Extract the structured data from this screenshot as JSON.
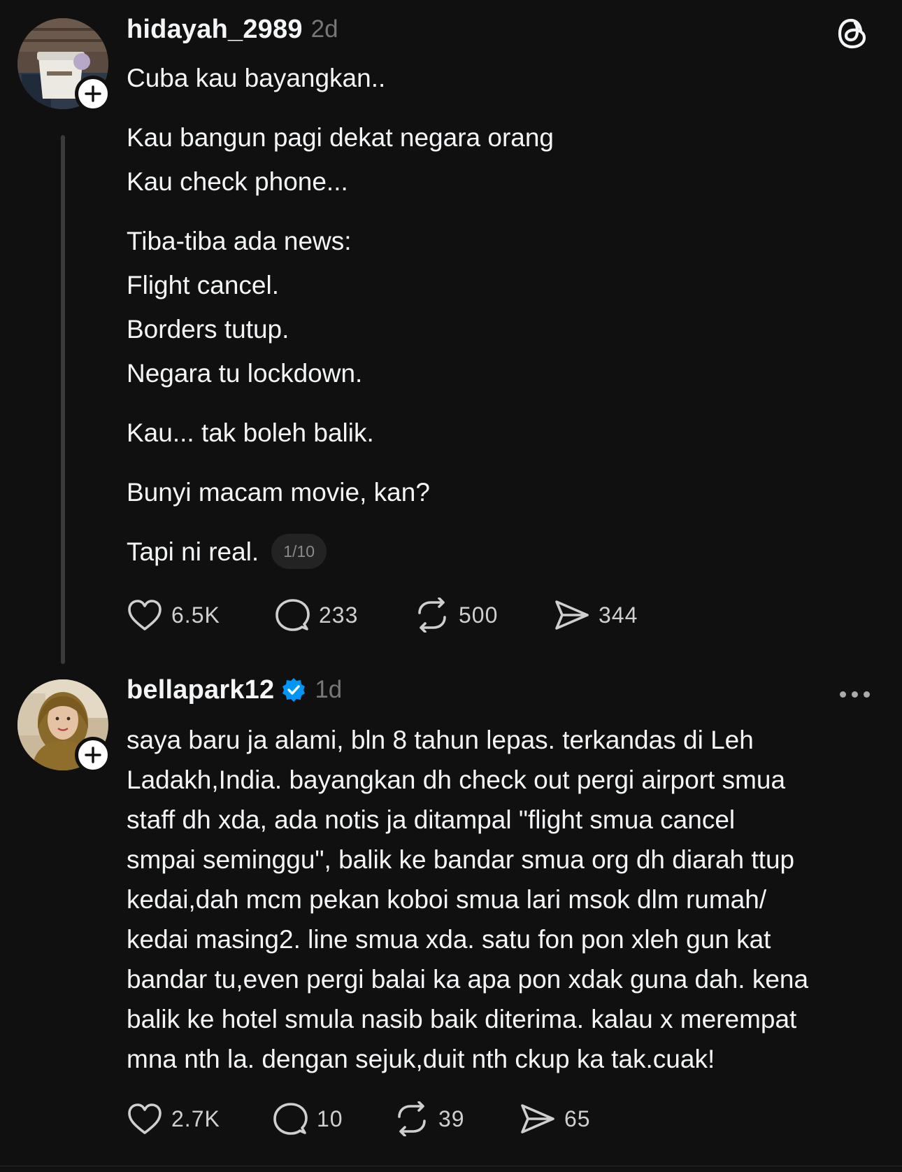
{
  "post1": {
    "username": "hidayah_2989",
    "time": "2d",
    "lines": [
      "Cuba kau bayangkan..",
      "",
      "Kau bangun pagi dekat negara orang",
      "Kau check phone...",
      "",
      "Tiba-tiba ada news:",
      "Flight cancel.",
      "Borders tutup.",
      "Negara tu lockdown.",
      "",
      "Kau... tak boleh balik.",
      "",
      "Bunyi macam movie, kan?",
      ""
    ],
    "last_line": "Tapi ni real.",
    "thread_counter": "1/10",
    "likes": "6.5K",
    "replies": "233",
    "reposts": "500",
    "shares": "344"
  },
  "post2": {
    "username": "bellapark12",
    "time": "1d",
    "text_lines": [
      "saya baru ja alami, bln 8 tahun lepas. terkandas di Leh",
      "Ladakh,India. bayangkan dh check out pergi airport smua",
      "staff dh xda, ada notis ja ditampal \"flight smua cancel",
      "smpai seminggu\", balik ke bandar smua org dh diarah ttup",
      "kedai,dah mcm pekan koboi smua lari msok dlm rumah/",
      "kedai masing2. line smua xda. satu fon pon xleh gun kat",
      "bandar tu,even pergi balai ka apa pon xdak guna dah. kena",
      "balik ke hotel smula nasib baik diterima. kalau x merempat",
      "mna nth la. dengan sejuk,duit nth ckup ka tak.cuak!"
    ],
    "likes": "2.7K",
    "replies": "10",
    "reposts": "39",
    "shares": "65"
  },
  "icons": {
    "app": "threads-logo-icon",
    "like": "heart-icon",
    "reply": "comment-icon",
    "repost": "repost-icon",
    "share": "send-icon",
    "follow": "plus-icon",
    "verified": "verified-badge-icon",
    "more": "more-options-icon"
  },
  "colors": {
    "background": "#101010",
    "text": "#f3f5f7",
    "muted": "#777777",
    "verified": "#0095f6"
  }
}
